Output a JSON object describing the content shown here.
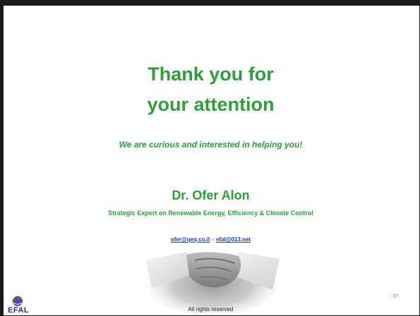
{
  "slide": {
    "title_line1": "Thank you for",
    "title_line2": "your attention",
    "subtitle": "We are curious and interested in helping you!",
    "presenter_name": "Dr. Ofer Alon",
    "presenter_role": "Strategic Expert on Renewable Energy, Efficiency & Climate Control",
    "email_1": "ofer@qeq.co.il",
    "separator": "-",
    "email_2": "efal@013.net",
    "footer": "All rights reserved",
    "page_number": "37",
    "logo": {
      "text": "EFAL",
      "icon": "globe-logo-icon"
    },
    "image": "handshake-image"
  },
  "colors": {
    "accent_green": "#2e9e3a",
    "link_blue": "#1f3fbf",
    "frame": "#1a1a1a"
  }
}
